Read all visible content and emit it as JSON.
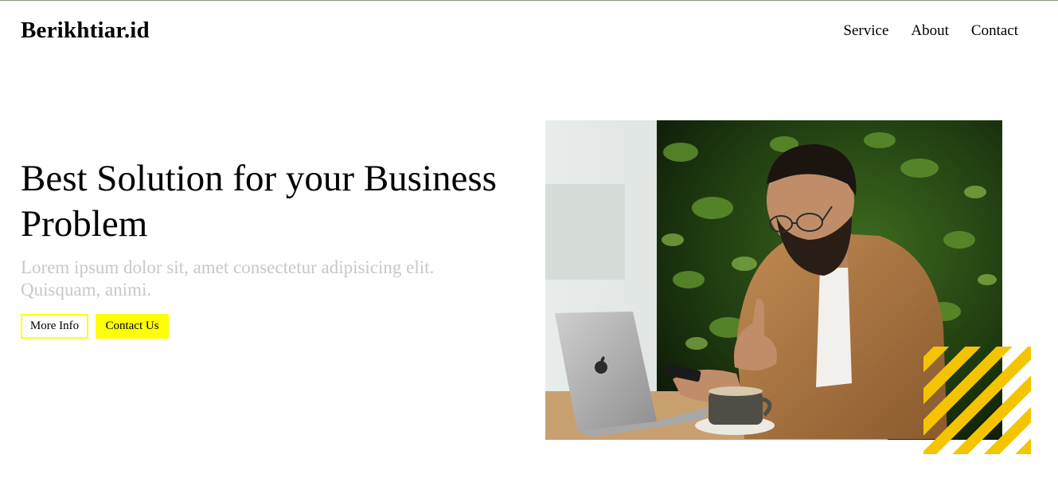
{
  "header": {
    "brand": "Berikhtiar.id",
    "nav": [
      {
        "label": "Service"
      },
      {
        "label": "About"
      },
      {
        "label": "Contact"
      }
    ]
  },
  "hero": {
    "headline": "Best Solution for your Business Problem",
    "subtext": "Lorem ipsum dolor sit, amet consectetur adipisicing elit. Quisquam, animi.",
    "more_info_label": "More Info",
    "contact_label": "Contact Us"
  },
  "colors": {
    "accent": "#ffff00",
    "stripe": "#f5c400",
    "subtext": "#c8c8c8"
  }
}
